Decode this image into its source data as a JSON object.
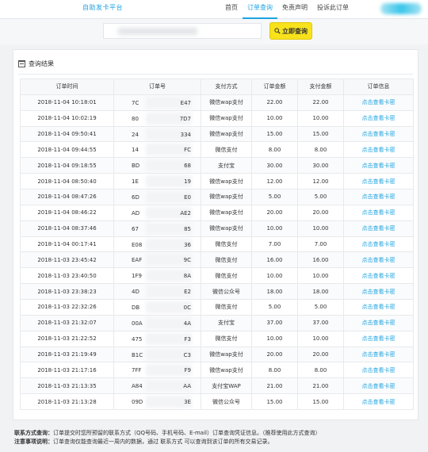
{
  "brand": "自助发卡平台",
  "nav": [
    "首页",
    "订单查询",
    "免责声明",
    "投诉此订单"
  ],
  "search": {
    "button_label": "立即查询"
  },
  "panel": {
    "title": "查询结果"
  },
  "table": {
    "headers": [
      "订单时间",
      "订单号",
      "支付方式",
      "订单金额",
      "支付金额",
      "订单信息"
    ],
    "link_label": "点击查看卡密",
    "rows": [
      {
        "time": "2018-11-04 10:18:01",
        "id_prefix": "7C",
        "id_suffix": "E47",
        "method": "微信wap支付",
        "amount": "22.00",
        "paid": "22.00"
      },
      {
        "time": "2018-11-04 10:02:19",
        "id_prefix": "80",
        "id_suffix": "7D7",
        "method": "微信wap支付",
        "amount": "10.00",
        "paid": "10.00"
      },
      {
        "time": "2018-11-04 09:50:41",
        "id_prefix": "24",
        "id_suffix": "334",
        "method": "微信wap支付",
        "amount": "15.00",
        "paid": "15.00"
      },
      {
        "time": "2018-11-04 09:44:55",
        "id_prefix": "14",
        "id_suffix": "FC",
        "method": "微信支付",
        "amount": "8.00",
        "paid": "8.00"
      },
      {
        "time": "2018-11-04 09:18:55",
        "id_prefix": "BD",
        "id_suffix": "68",
        "method": "支付宝",
        "amount": "30.00",
        "paid": "30.00"
      },
      {
        "time": "2018-11-04 08:50:40",
        "id_prefix": "1E",
        "id_suffix": "19",
        "method": "微信wap支付",
        "amount": "12.00",
        "paid": "12.00"
      },
      {
        "time": "2018-11-04 08:47:26",
        "id_prefix": "6D",
        "id_suffix": "E0",
        "method": "微信wap支付",
        "amount": "5.00",
        "paid": "5.00"
      },
      {
        "time": "2018-11-04 08:46:22",
        "id_prefix": "AD",
        "id_suffix": "AE2",
        "method": "微信wap支付",
        "amount": "20.00",
        "paid": "20.00"
      },
      {
        "time": "2018-11-04 08:37:46",
        "id_prefix": "67",
        "id_suffix": "85",
        "method": "微信wap支付",
        "amount": "10.00",
        "paid": "10.00"
      },
      {
        "time": "2018-11-04 00:17:41",
        "id_prefix": "E08",
        "id_suffix": "36",
        "method": "微信支付",
        "amount": "7.00",
        "paid": "7.00"
      },
      {
        "time": "2018-11-03 23:45:42",
        "id_prefix": "EAF",
        "id_suffix": "9C",
        "method": "微信支付",
        "amount": "16.00",
        "paid": "16.00"
      },
      {
        "time": "2018-11-03 23:40:50",
        "id_prefix": "1F9",
        "id_suffix": "8A",
        "method": "微信支付",
        "amount": "10.00",
        "paid": "10.00"
      },
      {
        "time": "2018-11-03 23:38:23",
        "id_prefix": "4D",
        "id_suffix": "E2",
        "method": "微信公众号",
        "amount": "18.00",
        "paid": "18.00"
      },
      {
        "time": "2018-11-03 22:32:26",
        "id_prefix": "DB",
        "id_suffix": "0C",
        "method": "微信支付",
        "amount": "5.00",
        "paid": "5.00"
      },
      {
        "time": "2018-11-03 21:32:07",
        "id_prefix": "00A",
        "id_suffix": "4A",
        "method": "支付宝",
        "amount": "37.00",
        "paid": "37.00"
      },
      {
        "time": "2018-11-03 21:22:52",
        "id_prefix": "475",
        "id_suffix": "F3",
        "method": "微信支付",
        "amount": "10.00",
        "paid": "10.00"
      },
      {
        "time": "2018-11-03 21:19:49",
        "id_prefix": "B1C",
        "id_suffix": "C3",
        "method": "微信wap支付",
        "amount": "20.00",
        "paid": "20.00"
      },
      {
        "time": "2018-11-03 21:17:16",
        "id_prefix": "7FF",
        "id_suffix": "F9",
        "method": "微信wap支付",
        "amount": "8.00",
        "paid": "8.00"
      },
      {
        "time": "2018-11-03 21:13:35",
        "id_prefix": "A84",
        "id_suffix": "AA",
        "method": "支付宝WAP",
        "amount": "21.00",
        "paid": "21.00"
      },
      {
        "time": "2018-11-03 21:13:28",
        "id_prefix": "09D",
        "id_suffix": "3E",
        "method": "微信公众号",
        "amount": "15.00",
        "paid": "15.00"
      }
    ]
  },
  "notes": {
    "contact_label": "联系方式查询：",
    "contact_text": "订单提交时您所预留的联系方式（QQ号码、手机号码、E-mail）订单查询凭证信息。（推荐使用此方式查询）",
    "notice_label": "注意事项说明：",
    "notice_text": "订单查询仅能查询最近一周内的数据，通过 联系方式 可以查询到该订单的所有交易记录。"
  },
  "colors": {
    "accent": "#1fa3e0",
    "button": "#f7e21b"
  }
}
